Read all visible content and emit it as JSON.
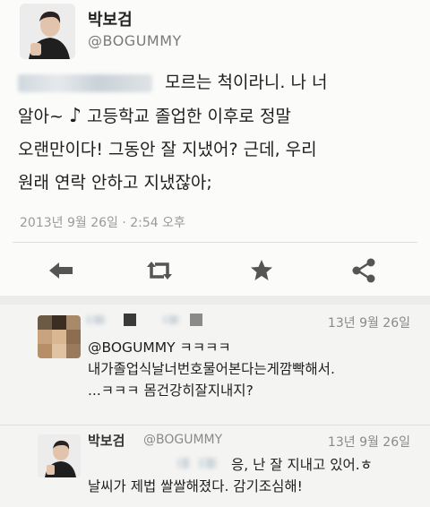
{
  "tweet": {
    "name": "박보검",
    "handle": "@BOGUMMY",
    "line1_text": "모르는 척이라니. 나 너",
    "line2_a": "알아~",
    "music_note": "♪",
    "line2_b": " 고등학교 졸업한 이후로 정말",
    "line3": "오랜만이다! 그동안 잘 지냈어? 근데, 우리",
    "line4": "원래 연락 안하고 지냈잖아;",
    "timestamp": "2013년 9월 26일 · 2:54 오후"
  },
  "actions": {
    "reply_icon": "reply-arrow-icon",
    "retweet_icon": "retweet-icon",
    "favorite_icon": "star-icon",
    "share_icon": "share-icon"
  },
  "reply1": {
    "date": "13년 9월 26일",
    "mention": "@BOGUMMY ㅋㅋㅋㅋ",
    "text1": "내가졸업식날너번호물어본다는게깜빡해서.",
    "text2": "...ㅋㅋㅋ 몸건강히잘지내지?"
  },
  "reply2": {
    "name": "박보검",
    "handle": "@BOGUMMY",
    "date": "13년 9월 26일",
    "text1": "응, 난 잘 지내고 있어.ㅎ",
    "text2": "날씨가 제법 쌀쌀해졌다. 감기조심해!"
  },
  "colors": {
    "text": "#1e1e1e",
    "secondary": "#8a8a8a",
    "icons": "#555555"
  }
}
